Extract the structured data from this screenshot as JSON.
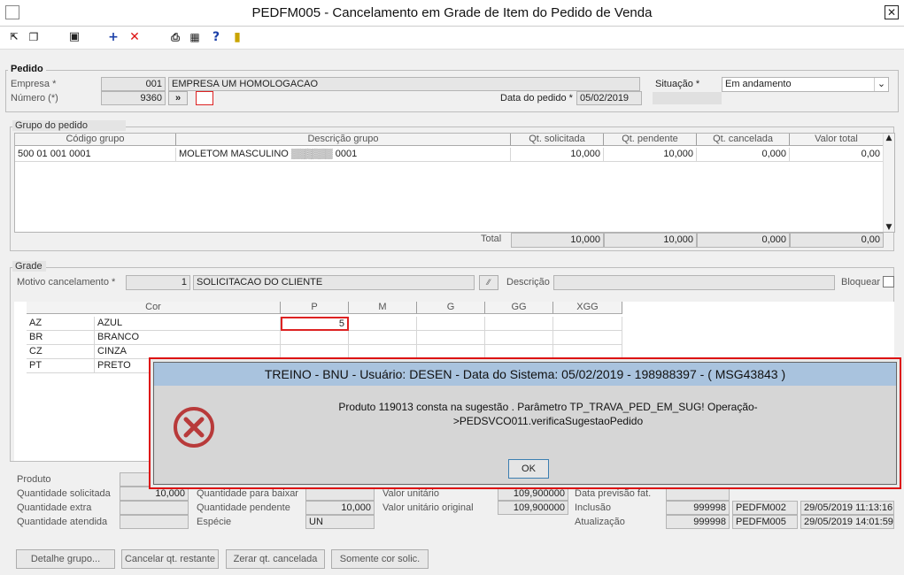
{
  "window": {
    "title": "PEDFM005 - Cancelamento em Grade de Item do Pedido de Venda",
    "close": "✕"
  },
  "pedido": {
    "section": "Pedido",
    "empresa_label": "Empresa *",
    "empresa_code": "001",
    "empresa_name": "EMPRESA UM  HOMOLOGACAO",
    "numero_label": "Número (*)",
    "numero": "9360",
    "situacao_label": "Situação *",
    "situacao": "Em andamento",
    "data_label": "Data do pedido *",
    "data": "05/02/2019"
  },
  "grupo": {
    "section": "Grupo do pedido",
    "headers": [
      "Código grupo",
      "Descrição grupo",
      "Qt. solicitada",
      "Qt. pendente",
      "Qt. cancelada",
      "Valor total"
    ],
    "rows": [
      [
        "500 01 001 0001",
        "MOLETOM MASCULINO ▒▒▒▒▒▒ 0001",
        "10,000",
        "10,000",
        "0,000",
        "0,00"
      ]
    ],
    "total_label": "Total",
    "totals": [
      "10,000",
      "10,000",
      "0,000",
      "0,00"
    ]
  },
  "grade": {
    "section": "Grade",
    "motivo_label": "Motivo cancelamento *",
    "motivo_code": "1",
    "motivo_desc": "SOLICITACAO DO CLIENTE",
    "descricao_label": "Descrição",
    "bloquear_label": "Bloquear",
    "headers": [
      "Cor",
      "P",
      "M",
      "G",
      "GG",
      "XGG"
    ],
    "rows": [
      {
        "code": "AZ",
        "name": "AZUL",
        "p": "5"
      },
      {
        "code": "BR",
        "name": "BRANCO",
        "p": ""
      },
      {
        "code": "CZ",
        "name": "CINZA",
        "p": ""
      },
      {
        "code": "PT",
        "name": "PRETO",
        "p": ""
      }
    ]
  },
  "produto": {
    "produto_label": "Produto",
    "qt_sol_label": "Quantidade solicitada",
    "qt_sol": "10,000",
    "qt_extra_label": "Quantidade extra",
    "qt_atend_label": "Quantidade atendida",
    "qt_baixar_label": "Quantidade para baixar",
    "qt_pend_label": "Quantidade pendente",
    "qt_pend": "10,000",
    "especie_label": "Espécie",
    "especie": "UN",
    "vu_label": "Valor unitário",
    "vu": "109,900000",
    "vuo_label": "Valor unitário original",
    "vuo": "109,900000",
    "prev_label": "Data previsão fat.",
    "inc_label": "Inclusão",
    "inc_user": "999998",
    "inc_prog": "PEDFM002",
    "inc_date": "29/05/2019 11:13:16",
    "atu_label": "Atualização",
    "atu_user": "999998",
    "atu_prog": "PEDFM005",
    "atu_date": "29/05/2019 14:01:59"
  },
  "buttons": {
    "detalhe": "Detalhe grupo...",
    "cancelar": "Cancelar qt. restante",
    "zerar": "Zerar qt. cancelada",
    "somente": "Somente cor solic."
  },
  "dialog": {
    "title": "TREINO - BNU - Usuário: DESEN - Data do Sistema: 05/02/2019 - 198988397 - ( MSG43843 )",
    "line1": "Produto 119013 consta na sugestão . Parâmetro TP_TRAVA_PED_EM_SUG! Operação-",
    "line2": ">PEDSVCO011.verificaSugestaoPedido",
    "ok": "OK",
    "error_color": "#b83a3a"
  }
}
